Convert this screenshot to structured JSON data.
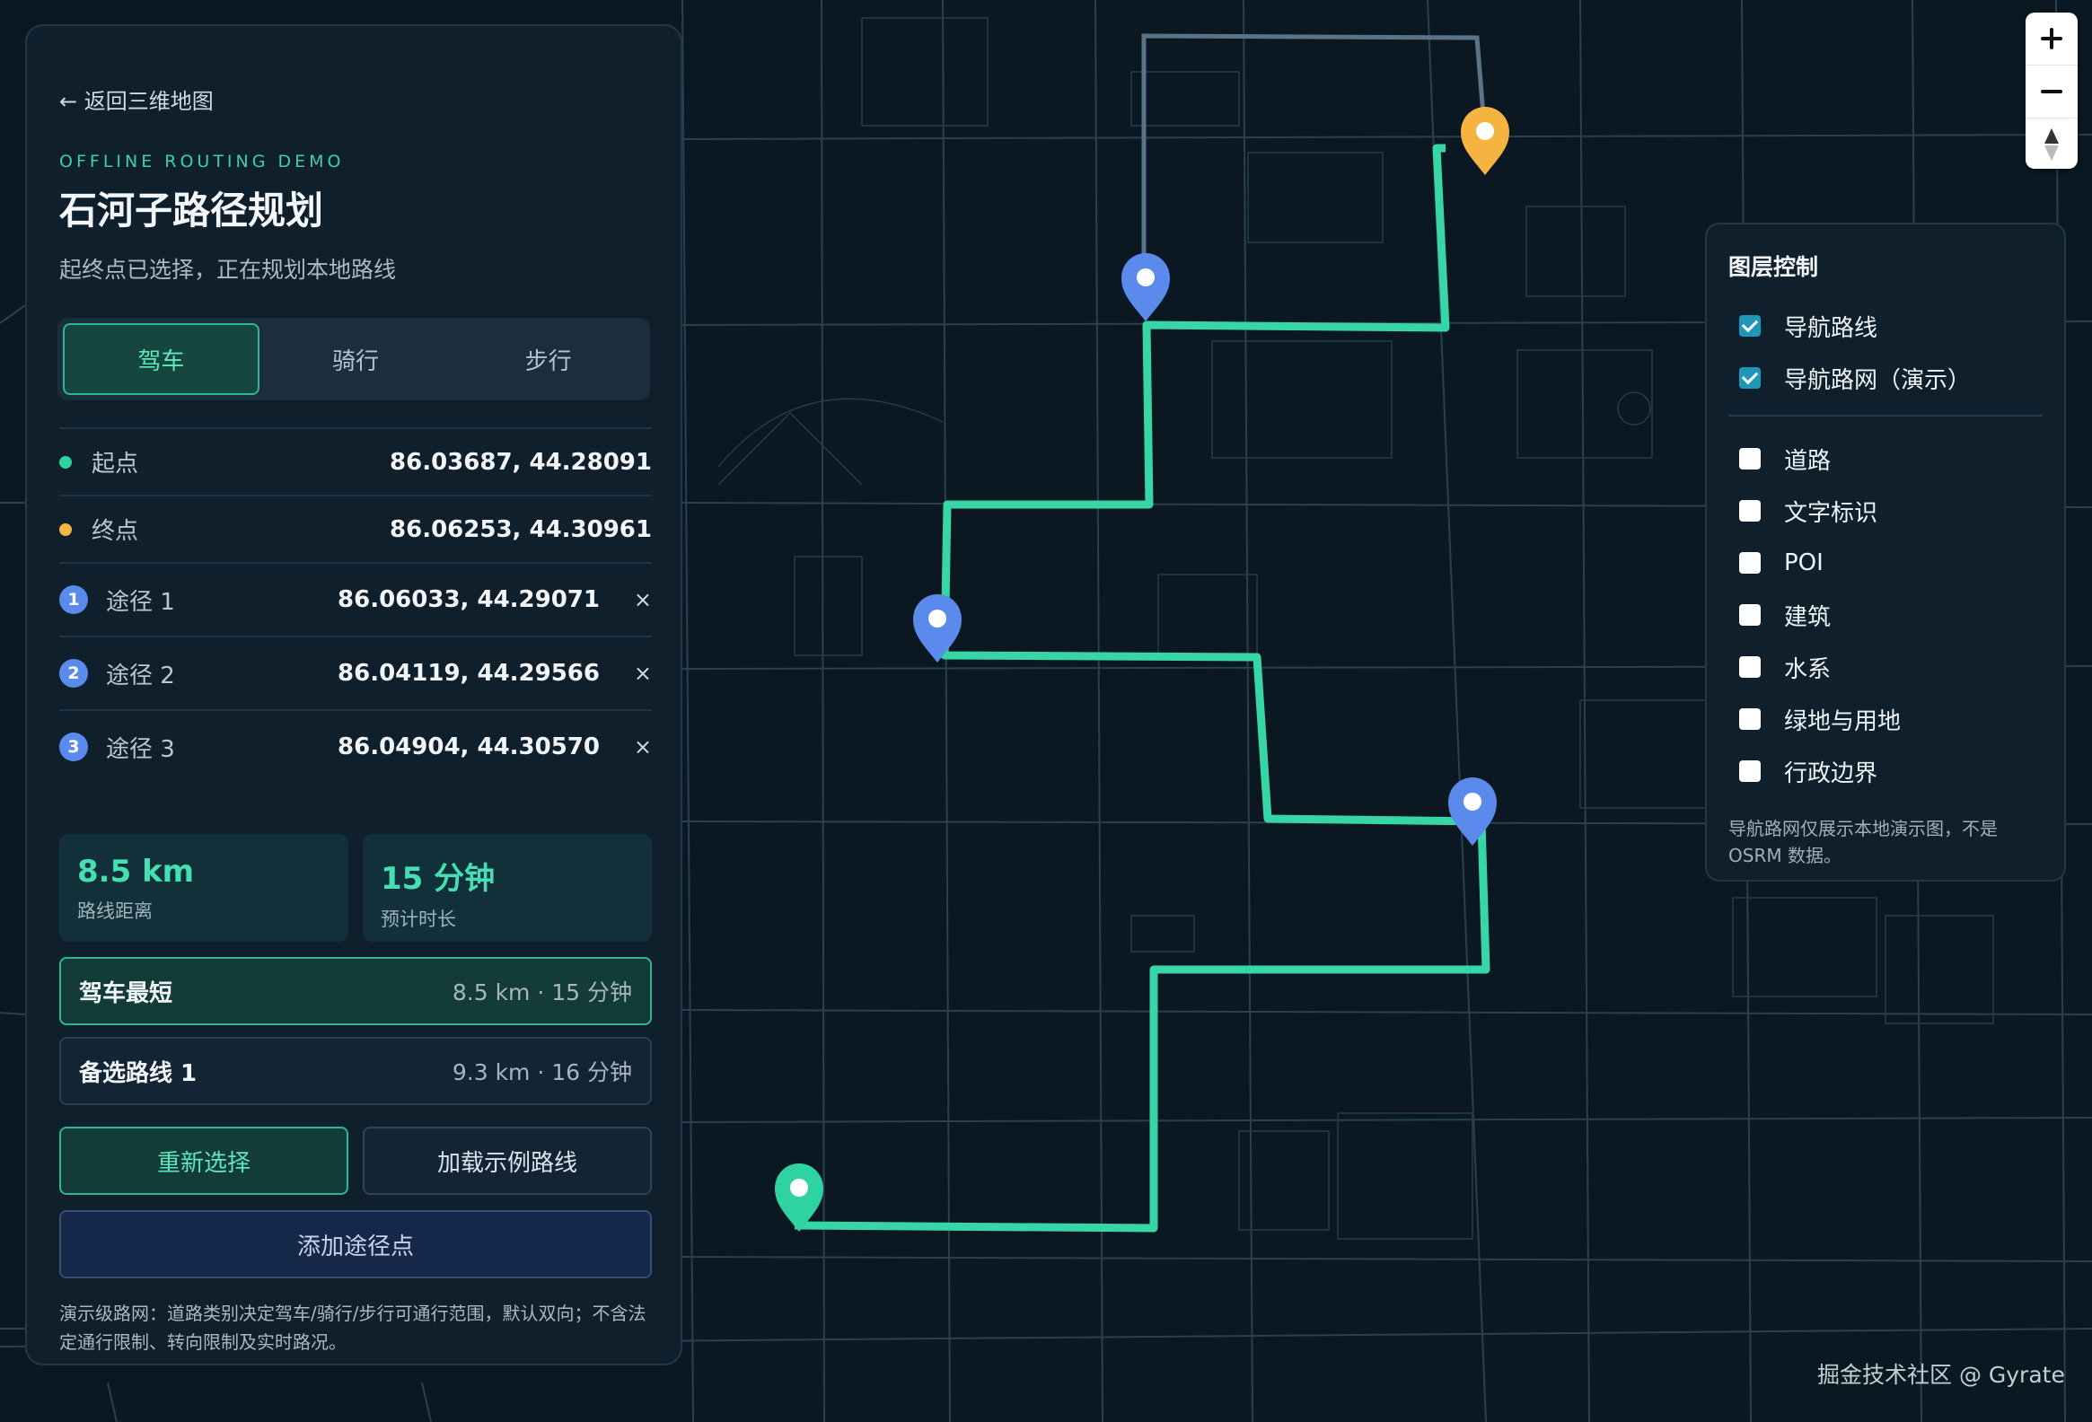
{
  "panel": {
    "back_label": "← 返回三维地图",
    "subtitle": "OFFLINE ROUTING DEMO",
    "title": "石河子路径规划",
    "status": "起终点已选择，正在规划本地路线",
    "modes": [
      {
        "label": "驾车",
        "active": true
      },
      {
        "label": "骑行",
        "active": false
      },
      {
        "label": "步行",
        "active": false
      }
    ],
    "start": {
      "label": "起点",
      "coord": "86.03687, 44.28091",
      "color": "#2fd3a2"
    },
    "end": {
      "label": "终点",
      "coord": "86.06253, 44.30961",
      "color": "#f5b440"
    },
    "waypoints": [
      {
        "index": "1",
        "label": "途径 1",
        "coord": "86.06033, 44.29071",
        "remove": "×"
      },
      {
        "index": "2",
        "label": "途径 2",
        "coord": "86.04119, 44.29566",
        "remove": "×"
      },
      {
        "index": "3",
        "label": "途径 3",
        "coord": "86.04904, 44.30570",
        "remove": "×"
      }
    ],
    "stats": {
      "distance_value": "8.5 km",
      "distance_label": "路线距离",
      "time_value": "15 分钟",
      "time_label": "预计时长"
    },
    "routes": [
      {
        "name": "驾车最短",
        "info": "8.5 km · 15 分钟",
        "active": true
      },
      {
        "name": "备选路线 1",
        "info": "9.3 km · 16 分钟",
        "active": false
      }
    ],
    "buttons": {
      "reset": "重新选择",
      "load": "加载示例路线",
      "add_waypoint": "添加途径点"
    },
    "footnote": "演示级路网：道路类别决定驾车/骑行/步行可通行范围，默认双向；不含法定通行限制、转向限制及实时路况。"
  },
  "layers": {
    "title": "图层控制",
    "primary": [
      {
        "label": "导航路线",
        "checked": true
      },
      {
        "label": "导航路网（演示）",
        "checked": true
      }
    ],
    "secondary": [
      {
        "label": "道路",
        "checked": false
      },
      {
        "label": "文字标识",
        "checked": false
      },
      {
        "label": "POI",
        "checked": false
      },
      {
        "label": "建筑",
        "checked": false
      },
      {
        "label": "水系",
        "checked": false
      },
      {
        "label": "绿地与用地",
        "checked": false
      },
      {
        "label": "行政边界",
        "checked": false
      }
    ],
    "note": "导航路网仅展示本地演示图，不是 OSRM 数据。"
  },
  "zoom": {
    "zoom_in_icon": "plus-icon",
    "zoom_out_icon": "minus-icon",
    "compass_icon": "compass-icon"
  },
  "watermark": "掘金技术社区 @ Gyrate",
  "colors": {
    "background": "#0b1821",
    "route": "#37d6a6",
    "accent": "#3ecfa6",
    "start_marker": "#2fd3a2",
    "end_marker": "#f5b440",
    "waypoint_marker": "#5a8bec"
  }
}
